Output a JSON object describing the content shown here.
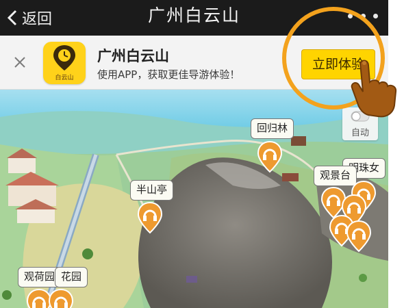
{
  "navbar": {
    "back_label": "返回",
    "title": "广州白云山"
  },
  "banner": {
    "app_icon_label": "白云山",
    "app_name": "广州白云山",
    "subtitle": "使用APP，获取更佳导游体验！",
    "cta_label": "立即体验"
  },
  "map": {
    "auto_label": "自动",
    "labels": {
      "huiguilin": "回归林",
      "mingzhu": "明珠女",
      "guanjingtai": "观景台",
      "banshanting": "半山亭",
      "guanheyuan": "观荷园",
      "huayuan": "花园"
    }
  },
  "colors": {
    "accent": "#ffd400",
    "pin": "#ee9a2f",
    "highlight_ring": "#f3a21d"
  }
}
